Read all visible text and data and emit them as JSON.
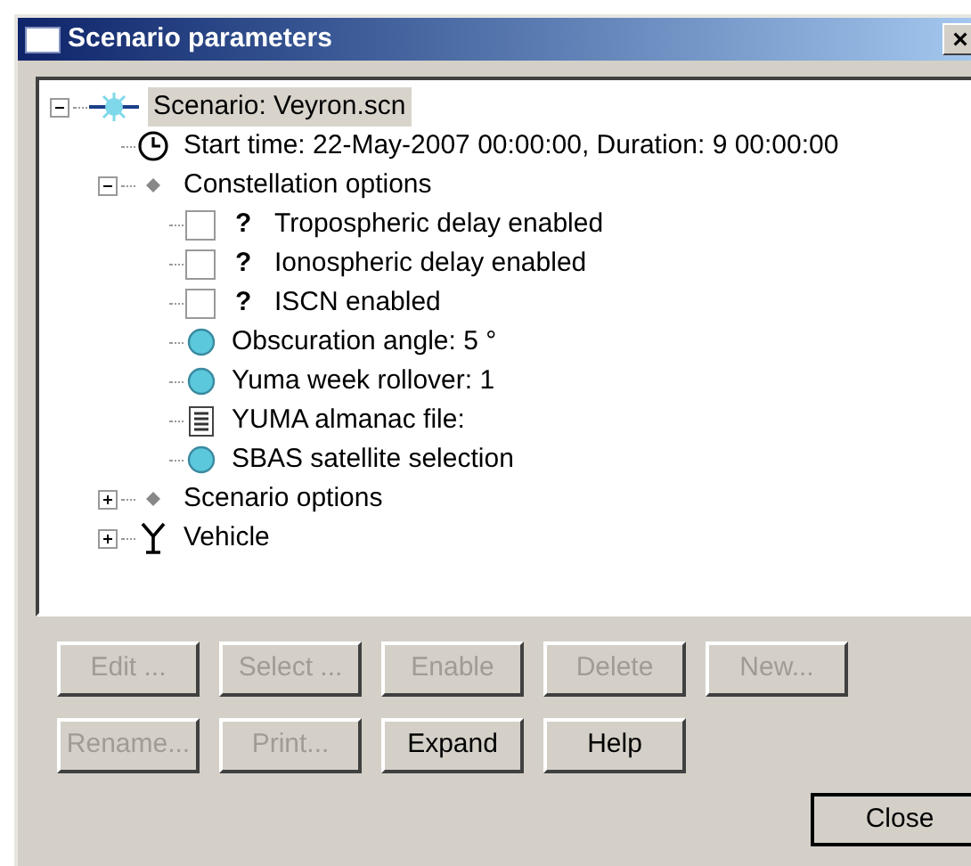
{
  "window": {
    "title": "Scenario parameters",
    "close_label": "×"
  },
  "tree": [
    {
      "kind": "scenario",
      "label": "Scenario: Veyron.scn",
      "selected": true,
      "expanded": true,
      "children": [
        {
          "kind": "clock",
          "label": "Start time: 22-May-2007 00:00:00, Duration: 9 00:00:00",
          "selected": false
        },
        {
          "kind": "group",
          "label": "Constellation options",
          "selected": false,
          "expanded": true,
          "children": [
            {
              "kind": "checkbox",
              "label": "Tropospheric delay enabled",
              "mark": "?",
              "checked": false,
              "selected": false
            },
            {
              "kind": "checkbox",
              "label": "Ionospheric delay enabled",
              "mark": "?",
              "checked": false,
              "selected": false
            },
            {
              "kind": "checkbox",
              "label": "ISCN enabled",
              "mark": "?",
              "checked": false,
              "selected": false
            },
            {
              "kind": "setting",
              "label": "Obscuration angle: 5 °",
              "selected": false
            },
            {
              "kind": "setting",
              "label": "Yuma week rollover: 1",
              "selected": false
            },
            {
              "kind": "file",
              "label": "YUMA almanac file:",
              "selected": false
            },
            {
              "kind": "setting",
              "label": "SBAS satellite selection",
              "selected": false
            }
          ]
        },
        {
          "kind": "group",
          "label": "Scenario options",
          "selected": false,
          "expanded": false
        },
        {
          "kind": "antenna",
          "label": "Vehicle",
          "selected": false,
          "expanded": false
        }
      ]
    }
  ],
  "buttons": [
    [
      {
        "label": "Edit ...",
        "disabled": true
      },
      {
        "label": "Select ...",
        "disabled": true
      },
      {
        "label": "Enable",
        "disabled": true
      },
      {
        "label": "Delete",
        "disabled": true
      },
      {
        "label": "New...",
        "disabled": true
      }
    ],
    [
      {
        "label": "Rename...",
        "disabled": true
      },
      {
        "label": "Print...",
        "disabled": true
      },
      {
        "label": "Expand",
        "disabled": false
      },
      {
        "label": "Help",
        "disabled": false
      }
    ]
  ],
  "close_button": {
    "label": "Close"
  }
}
